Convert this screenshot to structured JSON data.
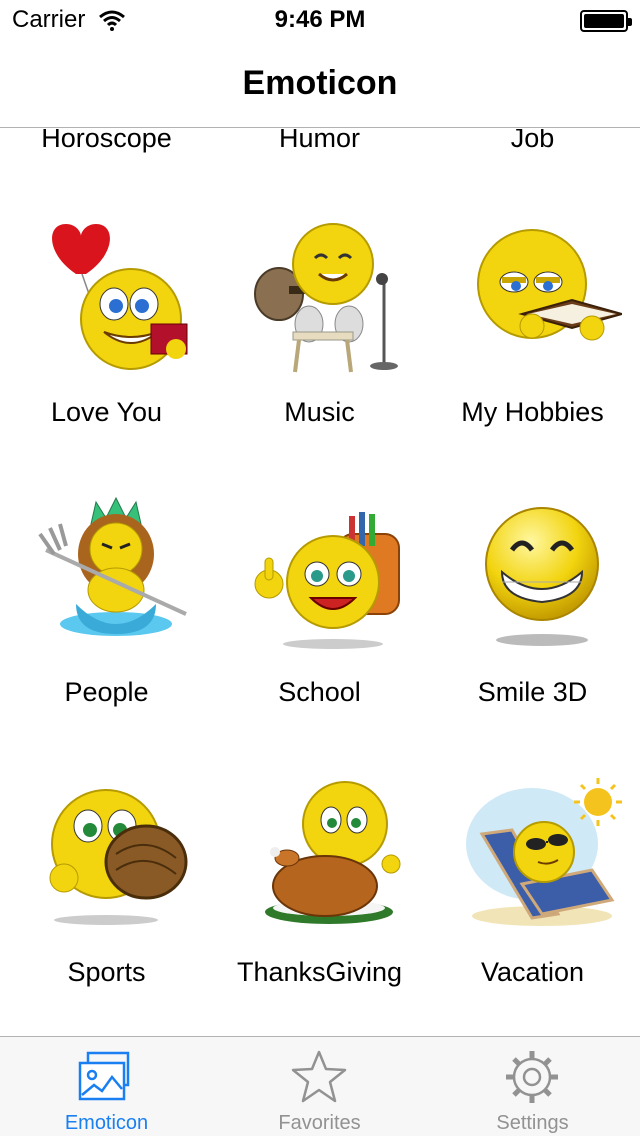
{
  "status_bar": {
    "carrier": "Carrier",
    "time": "9:46 PM",
    "battery_level": 1.0
  },
  "nav": {
    "title": "Emoticon"
  },
  "grid": {
    "partial_row": [
      {
        "label": "Horoscope"
      },
      {
        "label": "Humor"
      },
      {
        "label": "Job"
      }
    ],
    "items": [
      {
        "label": "Love You",
        "icon": "heart-balloon-smiley-icon"
      },
      {
        "label": "Music",
        "icon": "guitar-smiley-icon"
      },
      {
        "label": "My Hobbies",
        "icon": "reading-smiley-icon"
      },
      {
        "label": "People",
        "icon": "neptune-smiley-icon"
      },
      {
        "label": "School",
        "icon": "backpack-smiley-icon"
      },
      {
        "label": "Smile 3D",
        "icon": "grin-smiley-icon"
      },
      {
        "label": "Sports",
        "icon": "baseball-glove-smiley-icon"
      },
      {
        "label": "ThanksGiving",
        "icon": "turkey-smiley-icon"
      },
      {
        "label": "Vacation",
        "icon": "beach-chair-smiley-icon"
      }
    ]
  },
  "tab_bar": {
    "active_color": "#1a7ff0",
    "inactive_color": "#929292",
    "tabs": [
      {
        "label": "Emoticon",
        "icon": "photos-icon",
        "active": true
      },
      {
        "label": "Favorites",
        "icon": "star-icon",
        "active": false
      },
      {
        "label": "Settings",
        "icon": "gear-icon",
        "active": false
      }
    ]
  }
}
